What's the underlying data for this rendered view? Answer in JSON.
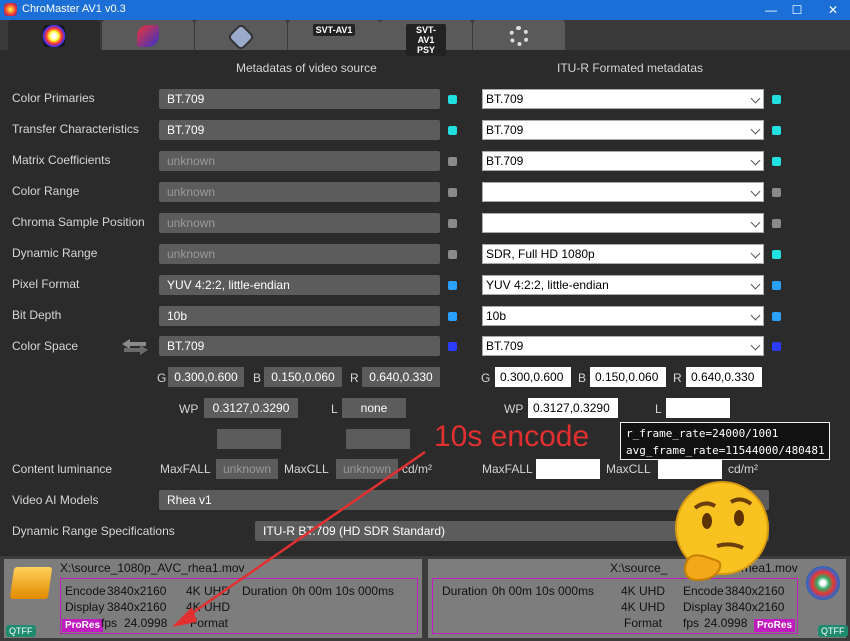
{
  "window": {
    "title": "ChroMaster AV1 v0.3",
    "minimize_glyph": "—",
    "maximize_glyph": "☐",
    "close_glyph": "✕"
  },
  "tabs": [
    {
      "icon": "color-wheel-icon",
      "label": ""
    },
    {
      "icon": "runner-icon",
      "label": ""
    },
    {
      "icon": "diamond-icon",
      "label": ""
    },
    {
      "icon": "svt-av1-icon",
      "label": "SVT-AV1"
    },
    {
      "icon": "svt-av1-psy-icon",
      "label": "SVT-AV1 PSY"
    },
    {
      "icon": "gears-icon",
      "label": ""
    }
  ],
  "headers": {
    "source": "Metadatas of video source",
    "itu": "ITU-R Formated metadatas"
  },
  "rows": [
    {
      "label": "Color Primaries",
      "source": "BT.709",
      "source_unknown": false,
      "source_dot": "#22e0e0",
      "itu": "BT.709",
      "itu_dot": "#22e0e0"
    },
    {
      "label": "Transfer Characteristics",
      "source": "BT.709",
      "source_unknown": false,
      "source_dot": "#22e0e0",
      "itu": "BT.709",
      "itu_dot": "#22e0e0"
    },
    {
      "label": "Matrix Coefficients",
      "source": "unknown",
      "source_unknown": true,
      "source_dot": "#8a8a8a",
      "itu": "BT.709",
      "itu_dot": "#22e0e0"
    },
    {
      "label": "Color Range",
      "source": "unknown",
      "source_unknown": true,
      "source_dot": "#8a8a8a",
      "itu": "",
      "itu_dot": "#8a8a8a"
    },
    {
      "label": "Chroma Sample Position",
      "source": "unknown",
      "source_unknown": true,
      "source_dot": "#8a8a8a",
      "itu": "",
      "itu_dot": "#8a8a8a"
    },
    {
      "label": "Dynamic Range",
      "source": "unknown",
      "source_unknown": true,
      "source_dot": "#8a8a8a",
      "itu": "SDR, Full HD 1080p",
      "itu_dot": "#22e0e0"
    },
    {
      "label": "Pixel Format",
      "source": "YUV 4:2:2, little-endian",
      "source_unknown": false,
      "source_dot": "#2aa0ff",
      "itu": "YUV 4:2:2, little-endian",
      "itu_dot": "#2aa0ff"
    },
    {
      "label": "Bit Depth",
      "source": "10b",
      "source_unknown": false,
      "source_dot": "#2aa0ff",
      "itu": "10b",
      "itu_dot": "#2aa0ff"
    },
    {
      "label": "Color Space",
      "source": "BT.709",
      "source_unknown": false,
      "source_dot": "#2b3bff",
      "itu": "BT.709",
      "itu_dot": "#2b3bff"
    }
  ],
  "coords_labels": {
    "g": "G",
    "b": "B",
    "r": "R",
    "wp": "WP",
    "l": "L"
  },
  "source_coords": {
    "g": "0.300,0.600",
    "b": "0.150,0.060",
    "r": "0.640,0.330",
    "wp": "0.3127,0.3290",
    "l": "none"
  },
  "itu_coords": {
    "g": "0.300,0.600",
    "b": "0.150,0.060",
    "r": "0.640,0.330",
    "wp": "0.3127,0.3290",
    "l": ""
  },
  "content_luminance": {
    "label": "Content luminance",
    "maxfall_label": "MaxFALL",
    "maxcll_label": "MaxCLL",
    "source_maxfall": "unknown",
    "source_maxcll": "unknown",
    "unit": "cd/m²",
    "itu_maxfall": "",
    "itu_maxcll": ""
  },
  "video_ai_models": {
    "label": "Video AI Models",
    "value": "Rhea v1"
  },
  "dynamic_range_spec": {
    "label": "Dynamic Range Specifications",
    "value": "ITU-R BT.709 (HD SDR Standard)"
  },
  "overlay": {
    "text": "10s encode",
    "arrow_color": "#e23030"
  },
  "tooltip": {
    "line1": "r_frame_rate=24000/1001",
    "line2": "avg_frame_rate=11544000/480481"
  },
  "status_left": {
    "path": "X:\\source_1080p_AVC_rhea1.mov",
    "encode_label": "Encode",
    "encode_res": "3840x2160",
    "encode_class": "4K UHD",
    "display_label": "Display",
    "display_res": "3840x2160",
    "display_class": "4K UHD",
    "duration_label": "Duration",
    "duration": "0h 00m 10s 000ms",
    "codec": "ProRes",
    "fps_label": "fps",
    "fps": "24.0998",
    "format_label": "Format",
    "container_badge": "QTFF"
  },
  "status_right": {
    "path": "X:\\source_",
    "path_tail": "rhea1.mov",
    "duration_label": "Duration",
    "duration": "0h 00m 10s 000ms",
    "encode_label": "Encode",
    "encode_res": "3840x2160",
    "encode_class": "4K UHD",
    "display_label": "Display",
    "display_res": "3840x2160",
    "display_class": "4K UHD",
    "format_label": "Format",
    "fps_label": "fps",
    "fps": "24.0998",
    "codec": "ProRes",
    "container_badge": "QTFF"
  }
}
